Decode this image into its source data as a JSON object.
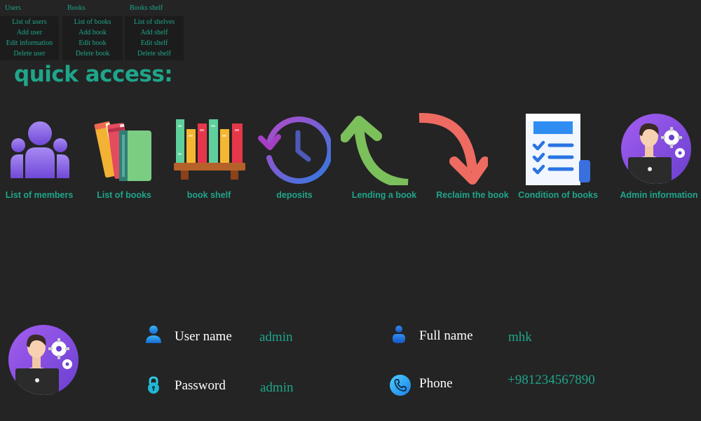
{
  "menus": [
    {
      "title": "Users",
      "items": [
        "List of users",
        "Add user",
        "Edit information",
        "Delete user"
      ]
    },
    {
      "title": "Books",
      "items": [
        "List of books",
        "Add book",
        "Edit book",
        "Delete book"
      ]
    },
    {
      "title": "Books shelf",
      "items": [
        "List of shelves",
        "Add shelf",
        "Edit shelf",
        "Delete shelf"
      ]
    }
  ],
  "quick_access": {
    "heading": "quick access:",
    "items": [
      {
        "label": "List of members",
        "icon": "members-icon"
      },
      {
        "label": "List of books",
        "icon": "books-icon"
      },
      {
        "label": "book shelf",
        "icon": "bookshelf-icon"
      },
      {
        "label": "deposits",
        "icon": "history-clock-icon"
      },
      {
        "label": "Lending a book",
        "icon": "curved-arrow-up-icon"
      },
      {
        "label": "Reclaim the book",
        "icon": "curved-arrow-down-icon"
      },
      {
        "label": "Condition of books",
        "icon": "checklist-icon"
      },
      {
        "label": "Admin information",
        "icon": "admin-avatar-icon"
      }
    ]
  },
  "profile": {
    "user_name_label": "User name",
    "user_name_value": "admin",
    "password_label": "Password",
    "password_value": "admin",
    "full_name_label": "Full name",
    "full_name_value": "mhk",
    "phone_label": "Phone",
    "phone_value": "+981234567890"
  },
  "colors": {
    "background": "#242424",
    "accent": "#1fa58a",
    "menu_bg": "#1c1c1c"
  }
}
